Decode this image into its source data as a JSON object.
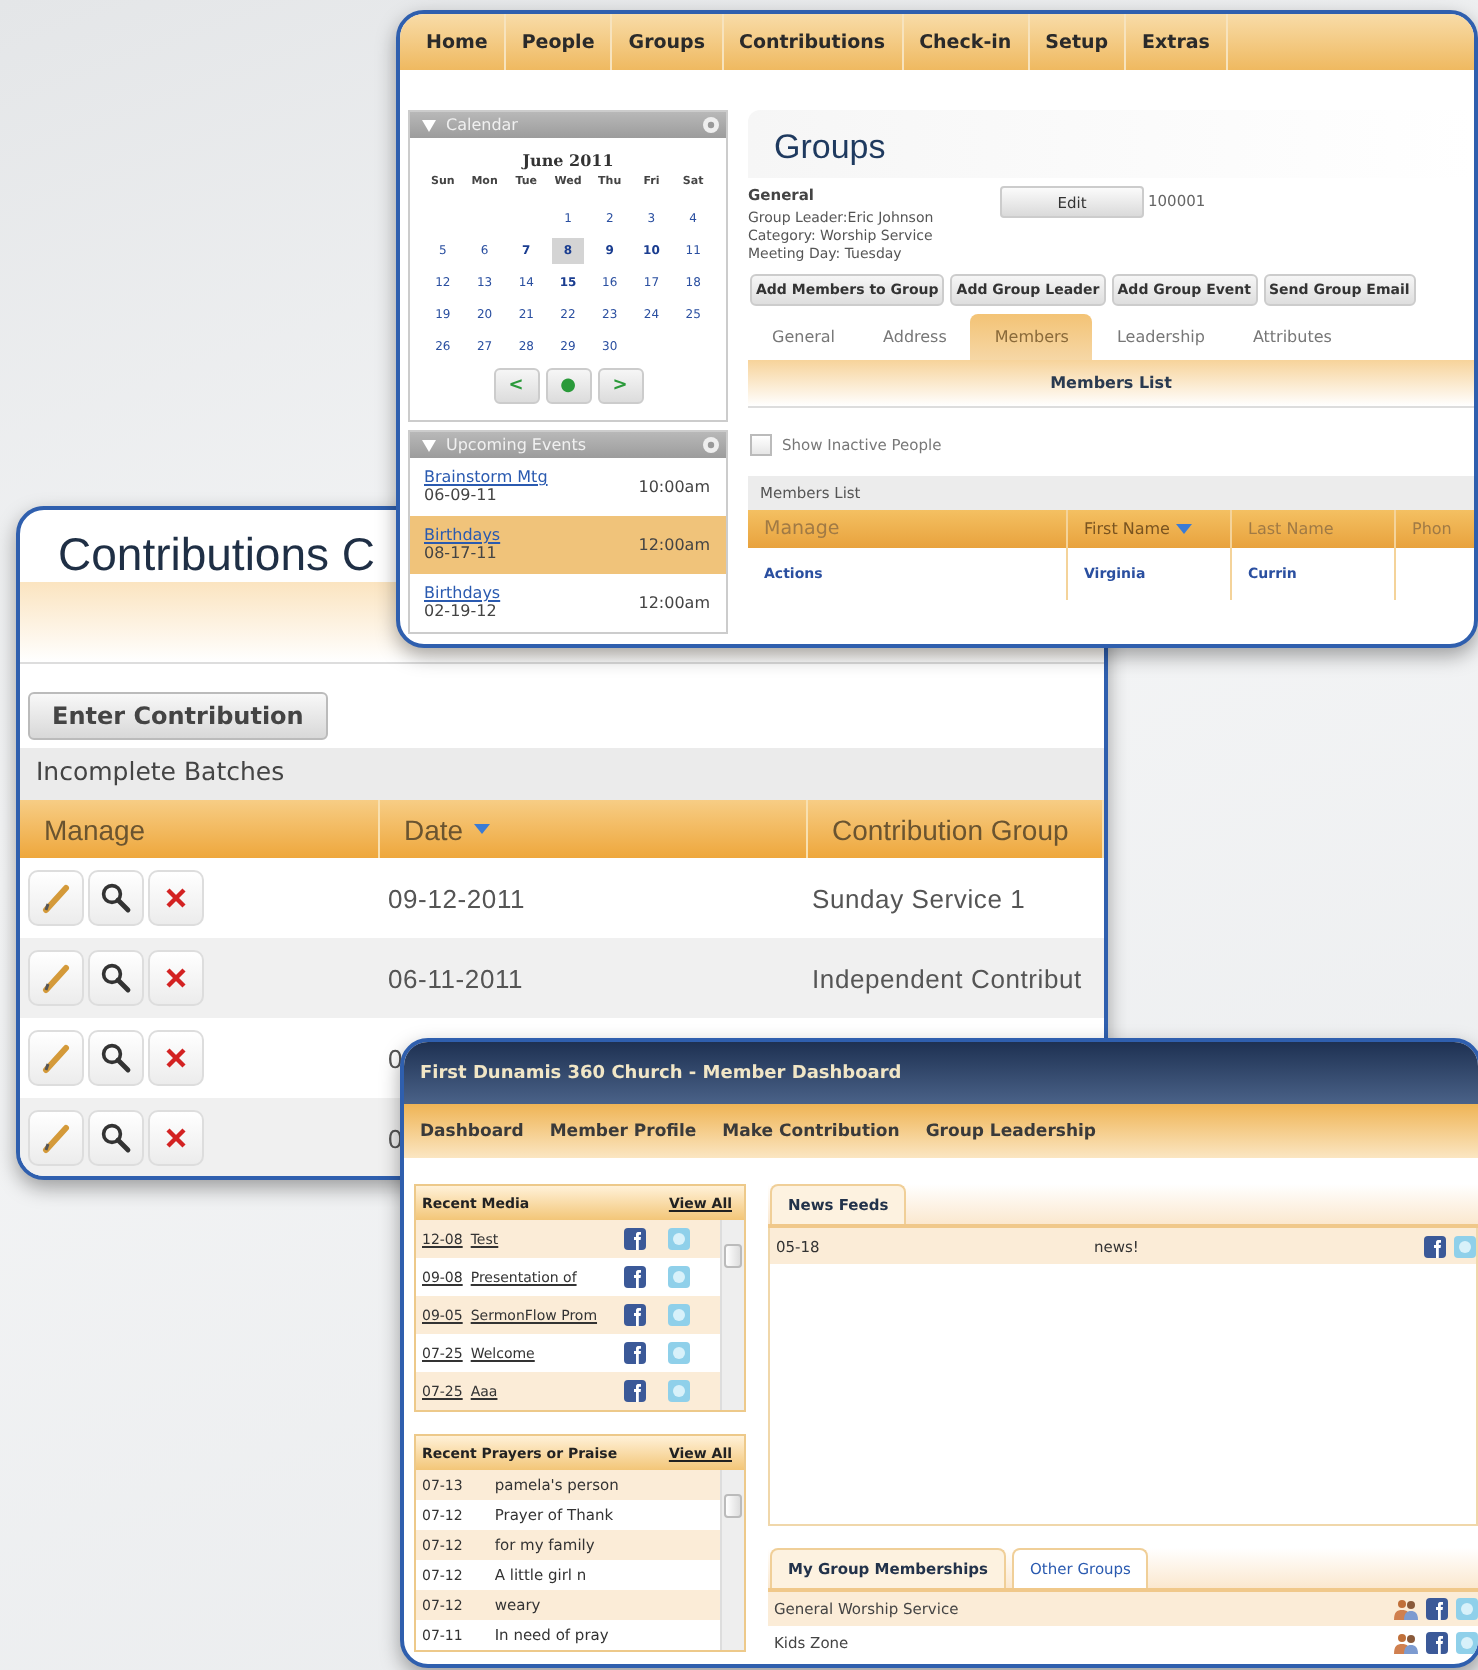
{
  "groups_window": {
    "nav": [
      "Home",
      "People",
      "Groups",
      "Contributions",
      "Check-in",
      "Setup",
      "Extras"
    ],
    "calendar": {
      "title": "Calendar",
      "month": "June 2011",
      "weekdays": [
        "Sun",
        "Mon",
        "Tue",
        "Wed",
        "Thu",
        "Fri",
        "Sat"
      ],
      "weeks": [
        {
          "days": [
            {
              "label": "1",
              "bold": false,
              "selected": false
            },
            {
              "label": "2",
              "bold": false,
              "selected": false
            },
            {
              "label": "3",
              "bold": false,
              "selected": false
            },
            {
              "label": "4",
              "bold": false,
              "selected": false
            }
          ]
        },
        {
          "days": [
            {
              "label": "5",
              "bold": false,
              "selected": false
            },
            {
              "label": "6",
              "bold": false,
              "selected": false
            },
            {
              "label": "7",
              "bold": true,
              "selected": false
            },
            {
              "label": "8",
              "bold": true,
              "selected": true
            },
            {
              "label": "9",
              "bold": true,
              "selected": false
            },
            {
              "label": "10",
              "bold": true,
              "selected": false
            },
            {
              "label": "11",
              "bold": false,
              "selected": false
            }
          ]
        },
        {
          "days": [
            {
              "label": "12",
              "bold": false,
              "selected": false
            },
            {
              "label": "13",
              "bold": false,
              "selected": false
            },
            {
              "label": "14",
              "bold": false,
              "selected": false
            },
            {
              "label": "15",
              "bold": true,
              "selected": false
            },
            {
              "label": "16",
              "bold": false,
              "selected": false
            },
            {
              "label": "17",
              "bold": false,
              "selected": false
            },
            {
              "label": "18",
              "bold": false,
              "selected": false
            }
          ]
        },
        {
          "days": [
            {
              "label": "19",
              "bold": false,
              "selected": false
            },
            {
              "label": "20",
              "bold": false,
              "selected": false
            },
            {
              "label": "21",
              "bold": false,
              "selected": false
            },
            {
              "label": "22",
              "bold": false,
              "selected": false
            },
            {
              "label": "23",
              "bold": false,
              "selected": false
            },
            {
              "label": "24",
              "bold": false,
              "selected": false
            },
            {
              "label": "25",
              "bold": false,
              "selected": false
            }
          ]
        },
        {
          "days": [
            {
              "label": "26",
              "bold": false,
              "selected": false
            },
            {
              "label": "27",
              "bold": false,
              "selected": false
            },
            {
              "label": "28",
              "bold": false,
              "selected": false
            },
            {
              "label": "29",
              "bold": false,
              "selected": false
            },
            {
              "label": "30",
              "bold": false,
              "selected": false
            }
          ]
        }
      ],
      "buttons": [
        "<",
        "●",
        ">"
      ]
    },
    "events_panel": {
      "title": "Upcoming Events",
      "events": [
        {
          "name": "Brainstorm Mtg",
          "date": "06-09-11",
          "time": "10:00am",
          "selected": false
        },
        {
          "name": "Birthdays",
          "date": "08-17-11",
          "time": "12:00am",
          "selected": true
        },
        {
          "name": "Birthdays",
          "date": "02-19-12",
          "time": "12:00am",
          "selected": false
        }
      ]
    },
    "page_title": "Groups",
    "group": {
      "name": "General",
      "edit_button": "Edit",
      "id": "100001",
      "details": [
        "Group Leader:Eric Johnson",
        "Category: Worship Service",
        "Meeting Day: Tuesday"
      ]
    },
    "actions": [
      "Add Members to Group",
      "Add Group Leader",
      "Add Group Event",
      "Send Group Email"
    ],
    "tabs": [
      {
        "label": "General",
        "selected": false
      },
      {
        "label": "Address",
        "selected": false
      },
      {
        "label": "Members",
        "selected": true
      },
      {
        "label": "Leadership",
        "selected": false
      },
      {
        "label": "Attributes",
        "selected": false
      }
    ],
    "section_title": "Members List",
    "show_inactive": {
      "label": "Show Inactive People",
      "checked": false
    },
    "members_table": {
      "title": "Members List",
      "columns": [
        {
          "label": "Manage",
          "sorted": false
        },
        {
          "label": "First Name",
          "sorted": true
        },
        {
          "label": "Last Name",
          "sorted": false
        },
        {
          "label": "Phon",
          "sorted": false
        }
      ],
      "rows": [
        [
          "Actions",
          "Virginia",
          "Currin"
        ]
      ]
    }
  },
  "contributions_window": {
    "title": "Contributions C",
    "enter_button": "Enter Contribution",
    "batches_title": "Incomplete Batches",
    "columns": [
      {
        "label": "Manage",
        "sorted": false
      },
      {
        "label": "Date",
        "sorted": true
      },
      {
        "label": "Contribution Group",
        "sorted": false
      }
    ],
    "rows": [
      {
        "date": "09-12-2011",
        "group": "Sunday Service 1"
      },
      {
        "date": "06-11-2011",
        "group": "Independent Contribut"
      },
      {
        "date": "0"
      },
      {
        "date": "0"
      }
    ]
  },
  "dashboard_window": {
    "title": "First Dunamis 360 Church - Member Dashboard",
    "nav": [
      "Dashboard",
      "Member Profile",
      "Make Contribution",
      "Group Leadership"
    ],
    "media": {
      "title": "Recent Media",
      "view_all": "View All",
      "items": [
        {
          "date": "12-08",
          "title": "Test"
        },
        {
          "date": "09-08",
          "title": "Presentation of"
        },
        {
          "date": "09-05",
          "title": "SermonFlow Prom"
        },
        {
          "date": "07-25",
          "title": "Welcome"
        },
        {
          "date": "07-25",
          "title": "Aaa"
        }
      ]
    },
    "prayers": {
      "title": "Recent Prayers or Praise",
      "view_all": "View All",
      "items": [
        {
          "date": "07-13",
          "text": "pamela's person"
        },
        {
          "date": "07-12",
          "text": "Prayer of Thank"
        },
        {
          "date": "07-12",
          "text": "for my family"
        },
        {
          "date": "07-12",
          "text": "A little girl n"
        },
        {
          "date": "07-12",
          "text": "weary"
        },
        {
          "date": "07-11",
          "text": "In need of pray"
        }
      ]
    },
    "news": {
      "tab": "News Feeds",
      "items": [
        {
          "date": "05-18",
          "text": "news!"
        }
      ]
    },
    "group_tabs": [
      {
        "label": "My Group Memberships",
        "selected": true
      },
      {
        "label": "Other Groups",
        "selected": false
      }
    ],
    "groups": [
      "General Worship Service",
      "Kids Zone"
    ]
  }
}
